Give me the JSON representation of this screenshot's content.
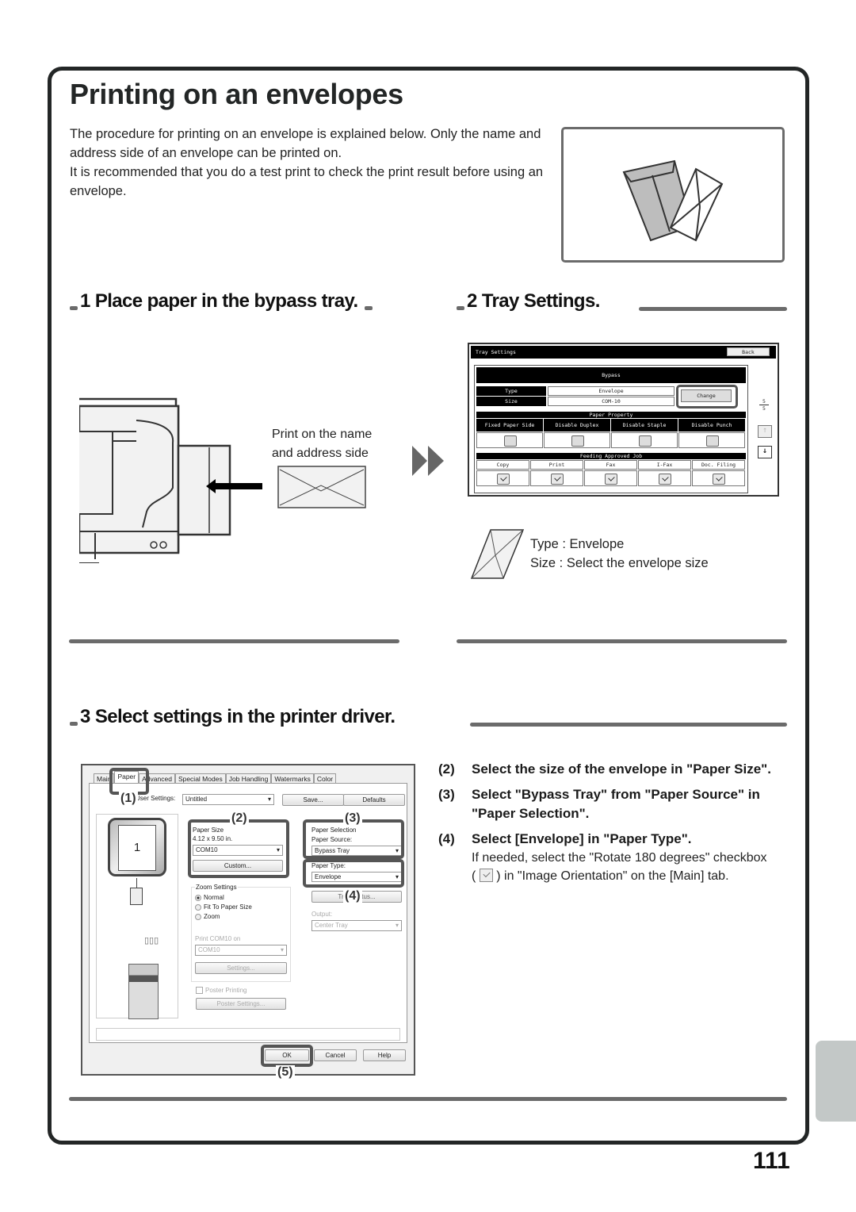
{
  "page": {
    "title": "Printing on an envelopes",
    "intro": [
      "The procedure for printing on an envelope is explained below. Only the name and address side of an envelope can be printed on.",
      "It is recommended that you do a test print to check the print result before using an envelope."
    ],
    "page_number": "111"
  },
  "steps": {
    "step1": {
      "heading": "1 Place paper in the bypass tray.",
      "caption_line1": "Print on the name",
      "caption_line2": "and address side"
    },
    "step2": {
      "heading": "2 Tray Settings.",
      "note_type": "Type : Envelope",
      "note_size": "Size : Select the envelope size"
    },
    "step3": {
      "heading": "3 Select settings in the printer driver."
    }
  },
  "tray_panel": {
    "title": "Tray Settings",
    "back_label": "Back",
    "tray_name": "Bypass",
    "type_label": "Type",
    "type_value": "Envelope",
    "size_label": "Size",
    "size_value": "COM-10",
    "change_label": "Change",
    "page_current": "5",
    "page_total": "5",
    "paper_property_label": "Paper Property",
    "properties": [
      {
        "label": "Fixed Paper Side",
        "checked": false
      },
      {
        "label": "Disable Duplex",
        "checked": false
      },
      {
        "label": "Disable Staple",
        "checked": false
      },
      {
        "label": "Disable Punch",
        "checked": false
      }
    ],
    "feeding_label": "Feeding Approved Job",
    "jobs": [
      {
        "label": "Copy",
        "checked": true
      },
      {
        "label": "Print",
        "checked": true
      },
      {
        "label": "Fax",
        "checked": true
      },
      {
        "label": "I-Fax",
        "checked": true
      },
      {
        "label": "Doc. Filing",
        "checked": true
      }
    ]
  },
  "driver": {
    "tabs": [
      "Main",
      "Paper",
      "Advanced",
      "Special Modes",
      "Job Handling",
      "Watermarks",
      "Color"
    ],
    "selected_tab": "Paper",
    "user_settings_label": "User Settings:",
    "user_settings_value": "Untitled",
    "save_label": "Save...",
    "defaults_label": "Defaults",
    "preview_page": "1",
    "paper_size_label": "Paper Size",
    "paper_size_dims": "4.12 x 9.50 in.",
    "paper_size_value": "COM10",
    "custom_label": "Custom...",
    "paper_selection_label": "Paper Selection",
    "paper_source_label": "Paper Source:",
    "paper_source_value": "Bypass Tray",
    "paper_type_label": "Paper Type:",
    "paper_type_value": "Envelope",
    "tray_status_label": "Tray Status...",
    "zoom_settings_label": "Zoom Settings",
    "zoom_options": [
      {
        "label": "Normal",
        "selected": true
      },
      {
        "label": "Fit To Paper Size",
        "selected": false
      },
      {
        "label": "Zoom",
        "selected": false
      }
    ],
    "print_on_label": "Print COM10 on",
    "print_on_value": "COM10",
    "settings_label": "Settings...",
    "output_label": "Output:",
    "output_value": "Center Tray",
    "poster_printing_label": "Poster Printing",
    "poster_settings_label": "Poster Settings...",
    "ok_label": "OK",
    "cancel_label": "Cancel",
    "help_label": "Help",
    "callouts": [
      "(1)",
      "(2)",
      "(3)",
      "(4)",
      "(5)"
    ]
  },
  "instructions": [
    {
      "num": "(2)",
      "text": "Select the size of the envelope in \"Paper Size\"."
    },
    {
      "num": "(3)",
      "text": "Select \"Bypass Tray\" from \"Paper Source\" in \"Paper Selection\"."
    },
    {
      "num": "(4)",
      "text": "Select [Envelope] in \"Paper Type\".",
      "note_before": "If needed, select the \"Rotate 180 degrees\" checkbox (",
      "note_after": ") in \"Image Orientation\" on the [Main] tab."
    }
  ]
}
